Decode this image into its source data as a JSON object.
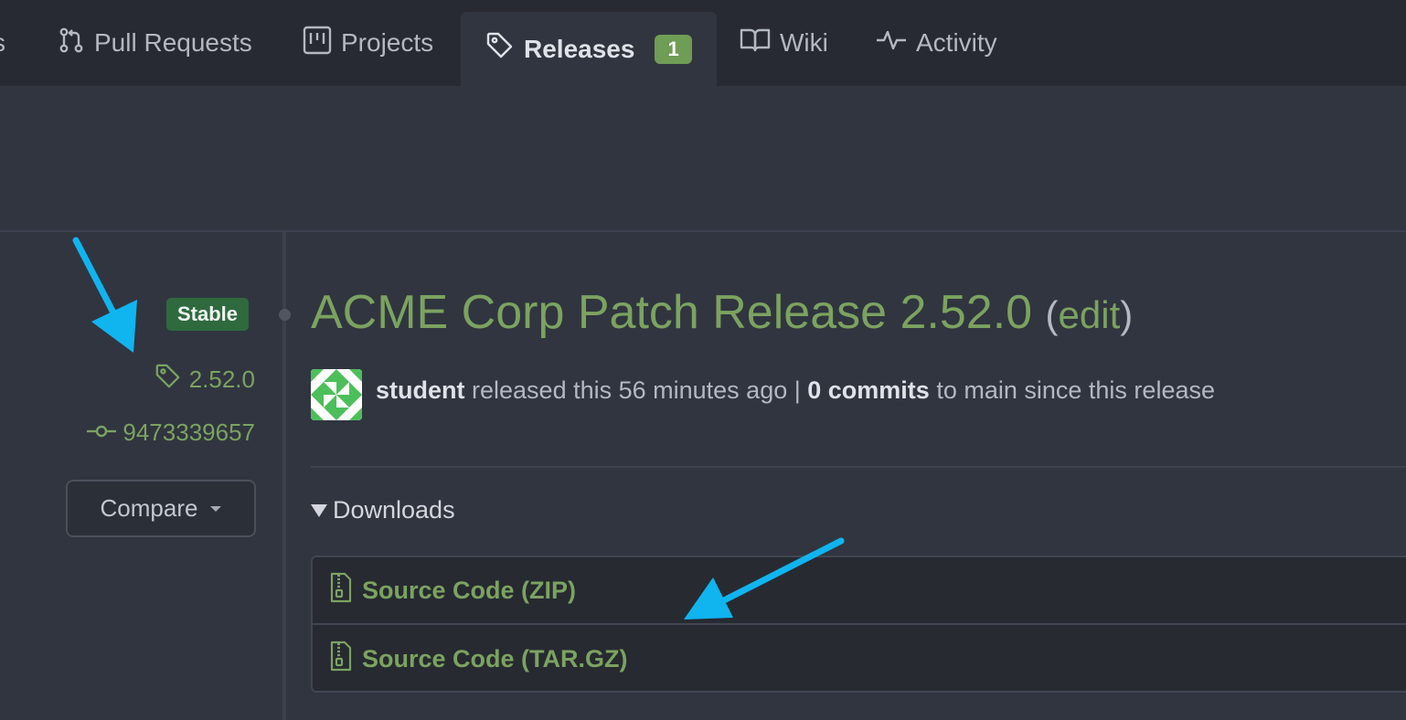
{
  "nav": {
    "cut_label": "s",
    "pulls_label": "Pull Requests",
    "projects_label": "Projects",
    "releases_label": "Releases",
    "releases_count": "1",
    "wiki_label": "Wiki",
    "activity_label": "Activity"
  },
  "sidebar": {
    "badge": "Stable",
    "tag": "2.52.0",
    "commit": "9473339657",
    "compare_label": "Compare"
  },
  "release": {
    "title": "ACME Corp Patch Release 2.52.0",
    "paren_open": "(",
    "edit_label": "edit",
    "paren_close": ")",
    "author": "student",
    "released_text": "released this 56 minutes ago |",
    "commits_count": "0 commits",
    "commits_suffix": "to main since this release"
  },
  "downloads": {
    "summary_label": "Downloads",
    "items": [
      {
        "label": "Source Code (ZIP)"
      },
      {
        "label": "Source Code (TAR.GZ)"
      }
    ]
  },
  "colors": {
    "accent_green": "#7ba35f",
    "badge_green": "#2e6a3e",
    "annotation_arrow": "#10b4ef",
    "background": "#313540",
    "nav_background": "#272a32"
  }
}
